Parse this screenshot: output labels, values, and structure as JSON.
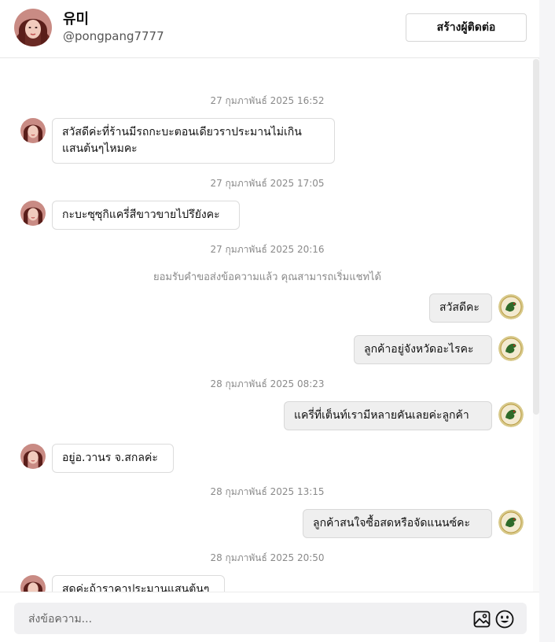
{
  "header": {
    "name": "유미",
    "handle": "@pongpang7777",
    "create_contact_label": "สร้างผู้ติดต่อ"
  },
  "messages": [
    {
      "type": "timestamp",
      "text": "27 กุมภาพันธ์ 2025 16:52"
    },
    {
      "type": "incoming",
      "text": "สวัสดีค่ะที่ร้านมีรถกะบะตอนเดียวราประมานไม่เกิน\nแสนต้นๆไหมคะ"
    },
    {
      "type": "timestamp",
      "text": "27 กุมภาพันธ์ 2025 17:05"
    },
    {
      "type": "incoming",
      "text": "กะบะซุซุกิแครี่สีขาวขายไปรึยังคะ"
    },
    {
      "type": "timestamp",
      "text": "27 กุมภาพันธ์ 2025 20:16"
    },
    {
      "type": "system",
      "text": "ยอมรับคำขอส่งข้อความแล้ว คุณสามารถเริ่มแชทได้"
    },
    {
      "type": "outgoing",
      "text": "สวัสดีคะ"
    },
    {
      "type": "outgoing",
      "text": "ลูกค้าอยู่จังหวัดอะไรคะ"
    },
    {
      "type": "timestamp",
      "text": "28 กุมภาพันธ์ 2025 08:23"
    },
    {
      "type": "outgoing",
      "text": "แครี่ที่เต็นท์เรามีหลายคันเลยค่ะลูกค้า"
    },
    {
      "type": "incoming",
      "text": "อยู่อ.วานร จ.สกลค่ะ"
    },
    {
      "type": "timestamp",
      "text": "28 กุมภาพันธ์ 2025 13:15"
    },
    {
      "type": "outgoing",
      "text": "ลูกค้าสนใจซื้อสดหรือจัดแนนซ์คะ"
    },
    {
      "type": "timestamp",
      "text": "28 กุมภาพันธ์ 2025 20:50"
    },
    {
      "type": "incoming",
      "text": "สดค่ะถ้าราคาประมานแสนต้นๆ"
    }
  ],
  "composer": {
    "placeholder": "ส่งข้อความ..."
  },
  "icons": {
    "image": "image-icon",
    "emoji": "emoji-icon"
  },
  "colors": {
    "outgoing_bubble": "#efefef",
    "incoming_bubble": "#ffffff",
    "timestamp_text": "#8a8a8a"
  }
}
